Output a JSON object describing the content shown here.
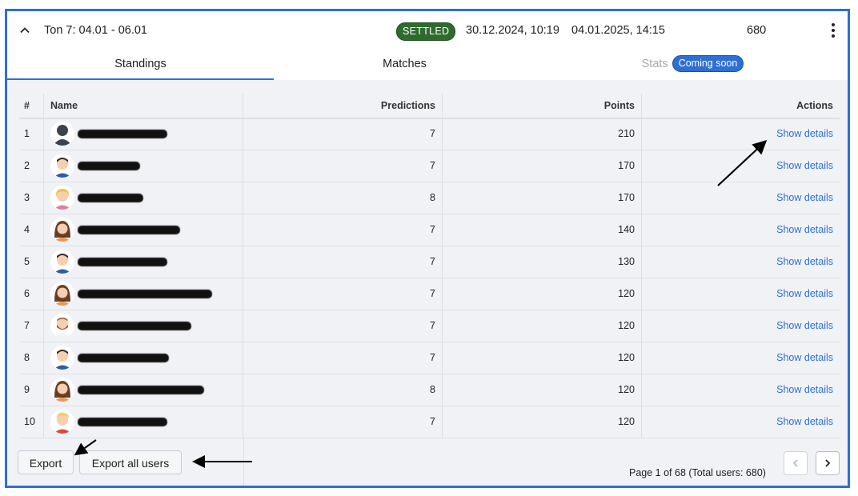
{
  "round": {
    "period_label": "Ton 7: 04.01 - 06.01",
    "status_badge": "SETTLED",
    "start": "30.12.2024, 10:19",
    "end": "04.01.2025, 14:15",
    "count": "680"
  },
  "tabs": {
    "standings": "Standings",
    "matches": "Matches",
    "stats": "Stats",
    "stats_badge": "Coming soon"
  },
  "table": {
    "headers": {
      "num": "#",
      "name": "Name",
      "predictions": "Predictions",
      "points": "Points",
      "actions": "Actions"
    },
    "action_label": "Show details",
    "rows": [
      {
        "num": "1",
        "predictions": "7",
        "points": "210"
      },
      {
        "num": "2",
        "predictions": "7",
        "points": "170"
      },
      {
        "num": "3",
        "predictions": "8",
        "points": "170"
      },
      {
        "num": "4",
        "predictions": "7",
        "points": "140"
      },
      {
        "num": "5",
        "predictions": "7",
        "points": "130"
      },
      {
        "num": "6",
        "predictions": "7",
        "points": "120"
      },
      {
        "num": "7",
        "predictions": "7",
        "points": "120"
      },
      {
        "num": "8",
        "predictions": "7",
        "points": "120"
      },
      {
        "num": "9",
        "predictions": "8",
        "points": "120"
      },
      {
        "num": "10",
        "predictions": "7",
        "points": "120"
      }
    ]
  },
  "footer": {
    "export_label": "Export",
    "export_all_label": "Export all users",
    "page_info": "Page 1 of 68 (Total users: 680)"
  },
  "colors": {
    "accent": "#2e6fd6",
    "settled": "#2f6b2f",
    "panel": "#f0f2f6"
  }
}
